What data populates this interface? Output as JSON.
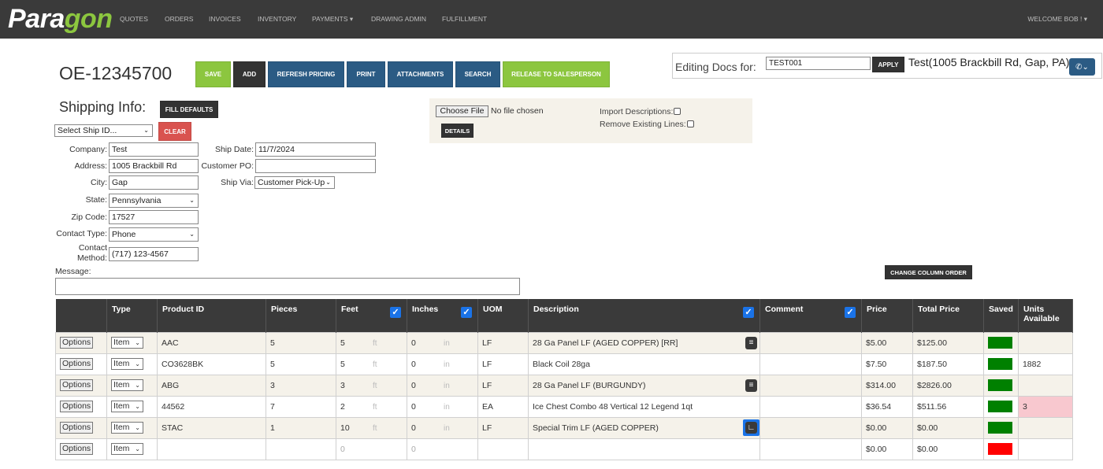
{
  "nav": {
    "logo_a": "Para",
    "logo_b": "gon",
    "items": [
      "QUOTES",
      "ORDERS",
      "INVOICES",
      "INVENTORY",
      "PAYMENTS ▾",
      "DRAWING ADMIN",
      "FULFILLMENT"
    ],
    "welcome": "WELCOME BOB ! ▾"
  },
  "order": {
    "number": "OE-12345700",
    "buttons": [
      "SAVE",
      "ADD",
      "REFRESH PRICING",
      "PRINT",
      "ATTACHMENTS",
      "SEARCH",
      "RELEASE TO SALESPERSON"
    ]
  },
  "editing": {
    "label": "Editing Docs for:",
    "value": "TEST001",
    "apply": "APPLY",
    "address": "Test(1005 Brackbill Rd, Gap, PA)",
    "toggle_icon": "phone-chevron-icon"
  },
  "shipping": {
    "title": "Shipping Info:",
    "fill_defaults": "FILL DEFAULTS",
    "select_ship_id": "Select Ship ID...",
    "clear": "CLEAR",
    "company_label": "Company:",
    "company": "Test",
    "address_label": "Address:",
    "address": "1005 Brackbill Rd",
    "city_label": "City:",
    "city": "Gap",
    "state_label": "State:",
    "state": "Pennsylvania",
    "zip_label": "Zip Code:",
    "zip": "17527",
    "contact_type_label": "Contact Type:",
    "contact_type": "Phone",
    "contact_method_label_1": "Contact",
    "contact_method_label_2": "Method:",
    "contact_method": "(717) 123-4567",
    "ship_date_label": "Ship Date:",
    "ship_date": "11/7/2024",
    "customer_po_label": "Customer PO:",
    "customer_po": "",
    "ship_via_label": "Ship Via:",
    "ship_via": "Customer Pick-Up",
    "message_label": "Message:"
  },
  "file": {
    "choose": "Choose File",
    "nofile": "No file chosen",
    "details": "DETAILS",
    "import_desc": "Import Descriptions:",
    "remove_lines": "Remove Existing Lines:"
  },
  "change_column_order": "CHANGE COLUMN ORDER",
  "table": {
    "headers": [
      "",
      "Type",
      "Product ID",
      "Pieces",
      "Feet",
      "Inches",
      "UOM",
      "Description",
      "Comment",
      "Price",
      "Total Price",
      "Saved",
      "Units Available"
    ],
    "options_label": "Options",
    "type_value": "Item",
    "feet_unit": "ft",
    "inches_unit": "in",
    "rows": [
      {
        "product": "AAC",
        "pieces": "5",
        "feet": "5",
        "inches": "0",
        "uom": "LF",
        "description": "28 Ga Panel LF (AGED COPPER) [RR]",
        "comment": "",
        "price": "$5.00",
        "total": "$125.00",
        "saved": "#008000",
        "units": "",
        "icon": "note"
      },
      {
        "product": "CO3628BK",
        "pieces": "5",
        "feet": "5",
        "inches": "0",
        "uom": "LF",
        "description": "Black Coil 28ga",
        "comment": "",
        "price": "$7.50",
        "total": "$187.50",
        "saved": "#008000",
        "units": "1882",
        "icon": ""
      },
      {
        "product": "ABG",
        "pieces": "3",
        "feet": "3",
        "inches": "0",
        "uom": "LF",
        "description": "28 Ga Panel LF (BURGUNDY)",
        "comment": "",
        "price": "$314.00",
        "total": "$2826.00",
        "saved": "#008000",
        "units": "",
        "icon": "note"
      },
      {
        "product": "44562",
        "pieces": "7",
        "feet": "2",
        "inches": "0",
        "uom": "EA",
        "description": "Ice Chest Combo 48 Vertical 12 Legend 1qt",
        "comment": "",
        "price": "$36.54",
        "total": "$511.56",
        "saved": "#008000",
        "units": "3",
        "icon": ""
      },
      {
        "product": "STAC",
        "pieces": "1",
        "feet": "10",
        "inches": "0",
        "uom": "LF",
        "description": "Special Trim LF (AGED COPPER)",
        "comment": "",
        "price": "$0.00",
        "total": "$0.00",
        "saved": "#008000",
        "units": "",
        "icon": "trim"
      },
      {
        "product": "",
        "pieces": "",
        "feet": "0",
        "inches": "0",
        "uom": "",
        "description": "",
        "comment": "",
        "price": "$0.00",
        "total": "$0.00",
        "saved": "#ff0000",
        "units": "",
        "icon": ""
      }
    ]
  }
}
